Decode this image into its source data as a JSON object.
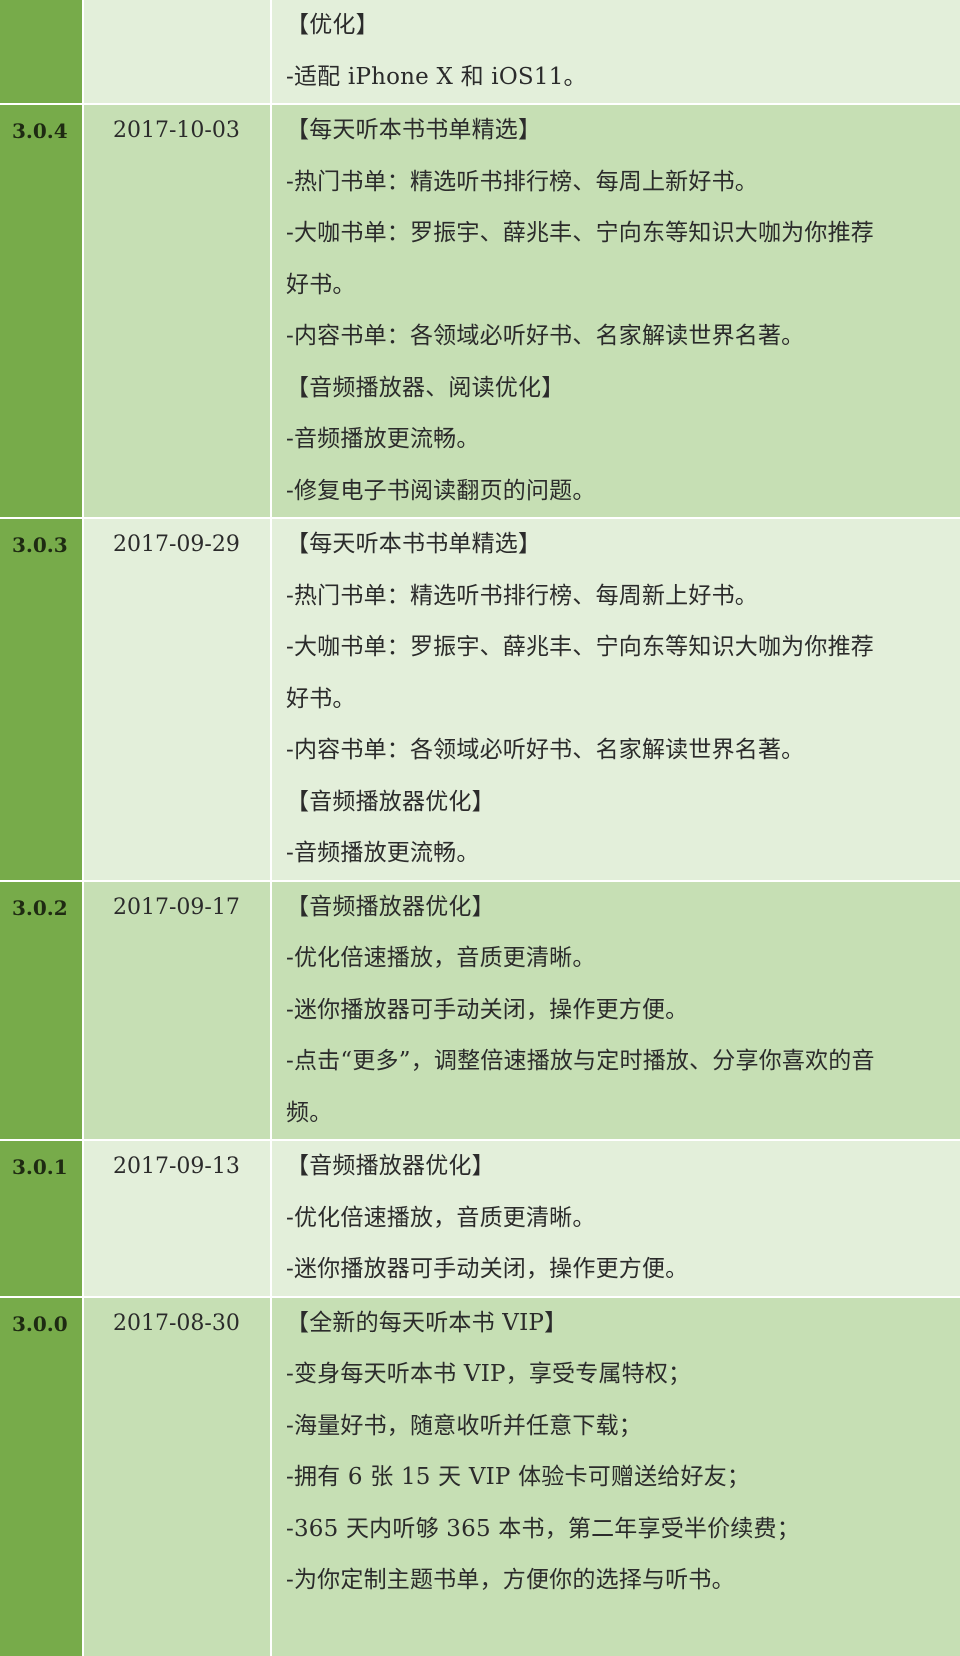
{
  "rows": [
    {
      "version": "",
      "date": "",
      "shade": "light",
      "lines": [
        "【优化】",
        "-适配 iPhone X 和 iOS11。"
      ]
    },
    {
      "version": "3.0.4",
      "date": "2017-10-03",
      "shade": "dark",
      "lines": [
        "【每天听本书书单精选】",
        "-热门书单：精选听书排行榜、每周上新好书。",
        "-大咖书单：罗振宇、薛兆丰、宁向东等知识大咖为你推荐",
        "好书。",
        "-内容书单：各领域必听好书、名家解读世界名著。",
        "【音频播放器、阅读优化】",
        "-音频播放更流畅。",
        "-修复电子书阅读翻页的问题。"
      ]
    },
    {
      "version": "3.0.3",
      "date": "2017-09-29",
      "shade": "light",
      "lines": [
        "【每天听本书书单精选】",
        "-热门书单：精选听书排行榜、每周新上好书。",
        "-大咖书单：罗振宇、薛兆丰、宁向东等知识大咖为你推荐",
        "好书。",
        "-内容书单：各领域必听好书、名家解读世界名著。",
        "【音频播放器优化】",
        "-音频播放更流畅。"
      ]
    },
    {
      "version": "3.0.2",
      "date": "2017-09-17",
      "shade": "dark",
      "lines": [
        "【音频播放器优化】",
        "-优化倍速播放，音质更清晰。",
        "-迷你播放器可手动关闭，操作更方便。",
        "-点击“更多”，调整倍速播放与定时播放、分享你喜欢的音",
        "频。"
      ]
    },
    {
      "version": "3.0.1",
      "date": "2017-09-13",
      "shade": "light",
      "lines": [
        "【音频播放器优化】",
        "-优化倍速播放，音质更清晰。",
        "-迷你播放器可手动关闭，操作更方便。"
      ]
    },
    {
      "version": "3.0.0",
      "date": "2017-08-30",
      "shade": "dark",
      "lines": [
        "【全新的每天听本书 VIP】",
        "-变身每天听本书 VIP，享受专属特权；",
        "-海量好书，随意收听并任意下载；",
        "-拥有 6 张 15 天 VIP 体验卡可赠送给好友；",
        "-365 天内听够 365 本书，第二年享受半价续费；",
        "-为你定制主题书单，方便你的选择与听书。"
      ]
    }
  ]
}
